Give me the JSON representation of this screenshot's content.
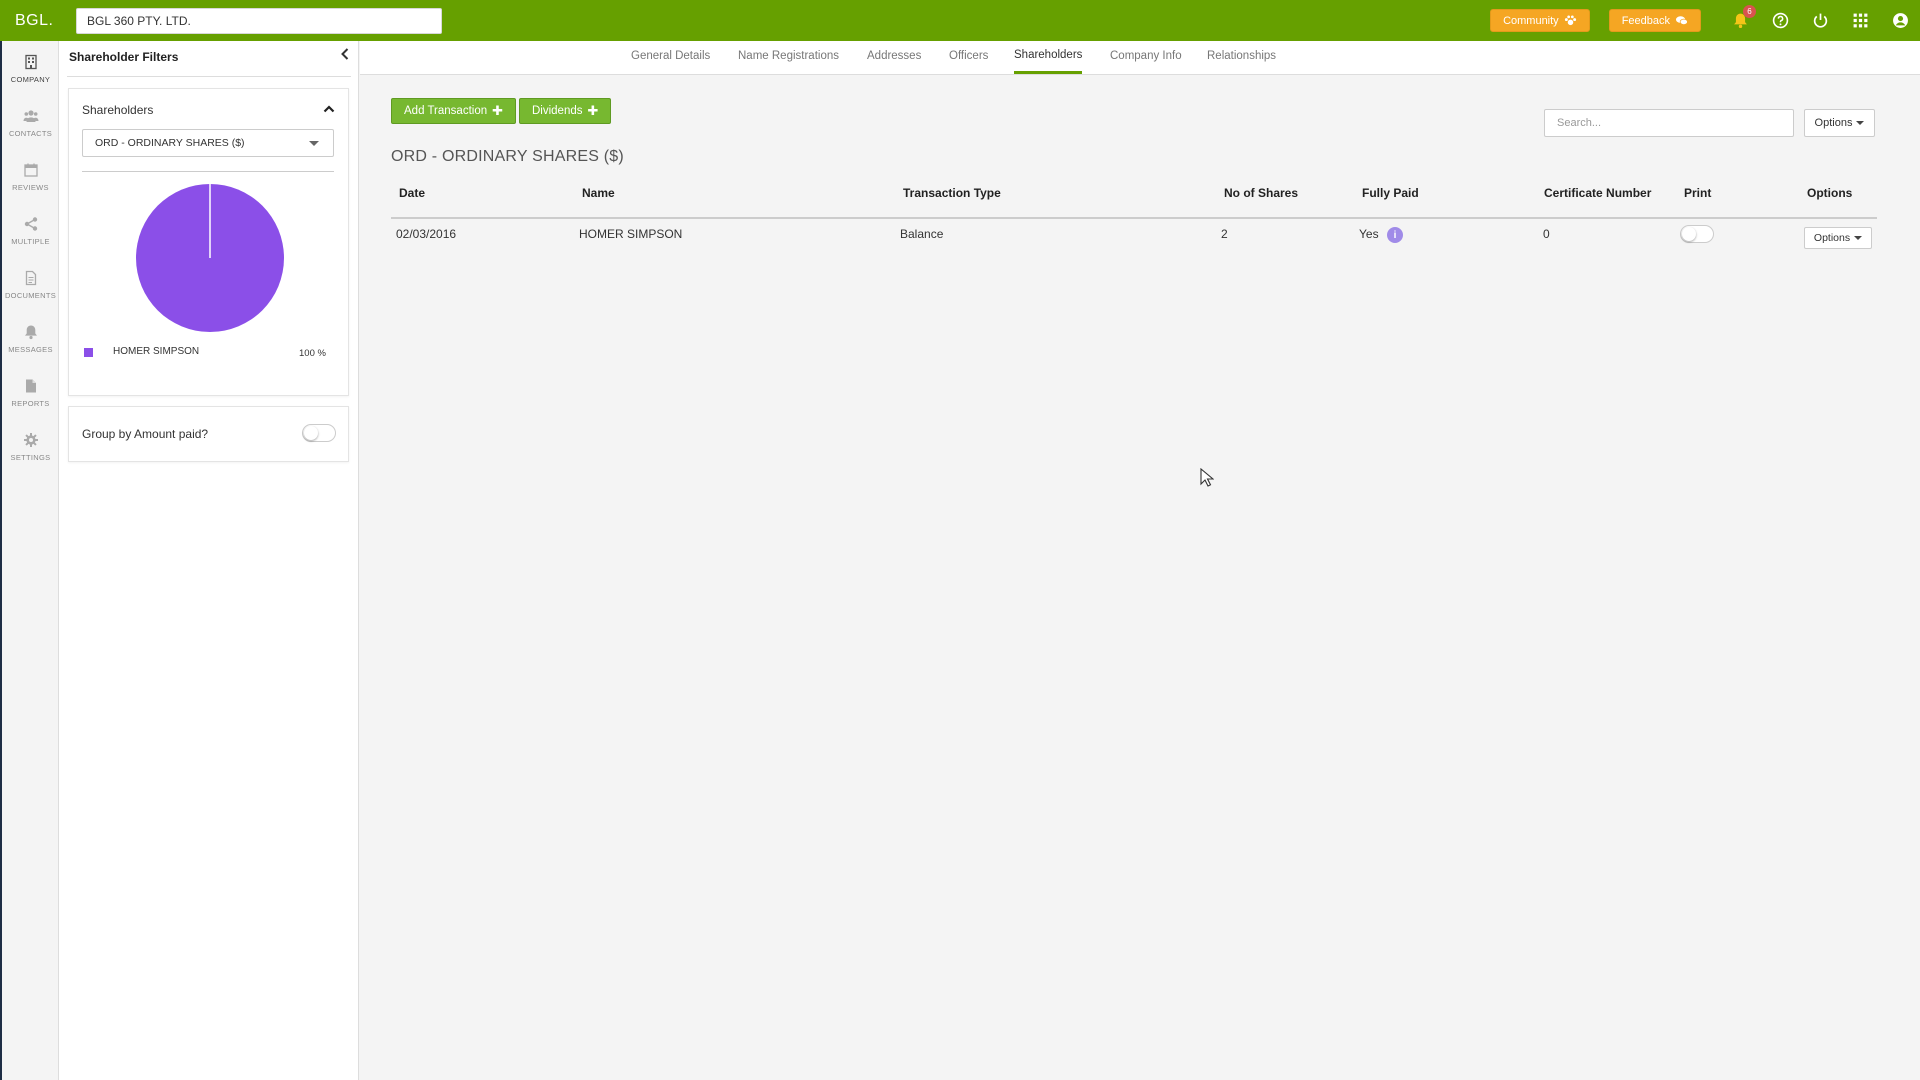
{
  "topbar": {
    "logo": "BGL.",
    "entity_name": "BGL 360 PTY. LTD.",
    "community_label": "Community",
    "feedback_label": "Feedback",
    "notification_count": "6",
    "colors": {
      "bar": "#66a000",
      "pill": "#f5a623"
    }
  },
  "leftnav": {
    "items": [
      {
        "label": "COMPANY",
        "icon": "building-icon"
      },
      {
        "label": "CONTACTS",
        "icon": "contacts-icon"
      },
      {
        "label": "REVIEWS",
        "icon": "calendar-icon"
      },
      {
        "label": "MULTIPLE",
        "icon": "share-icon"
      },
      {
        "label": "DOCUMENTS",
        "icon": "document-icon"
      },
      {
        "label": "MESSAGES",
        "icon": "bell-icon"
      },
      {
        "label": "REPORTS",
        "icon": "report-icon"
      },
      {
        "label": "SETTINGS",
        "icon": "gear-icon"
      }
    ]
  },
  "filters": {
    "title": "Shareholder Filters",
    "shareholders_heading": "Shareholders",
    "share_class_selected": "ORD - ORDINARY SHARES ($)",
    "group_by_label": "Group by Amount paid?",
    "group_by_enabled": false
  },
  "chart_data": {
    "type": "pie",
    "slices": [
      {
        "label": "HOMER SIMPSON",
        "value": 100,
        "display": "100 %",
        "color": "#8b4fe8"
      }
    ]
  },
  "tabs": [
    {
      "label": "General Details",
      "active": false
    },
    {
      "label": "Name Registrations",
      "active": false
    },
    {
      "label": "Addresses",
      "active": false
    },
    {
      "label": "Officers",
      "active": false
    },
    {
      "label": "Shareholders",
      "active": true
    },
    {
      "label": "Company Info",
      "active": false
    },
    {
      "label": "Relationships",
      "active": false
    }
  ],
  "main": {
    "add_transaction_label": "Add Transaction",
    "dividends_label": "Dividends",
    "search_placeholder": "Search...",
    "options_label": "Options",
    "section_title": "ORD - ORDINARY SHARES ($)"
  },
  "table": {
    "headers": [
      "Date",
      "Name",
      "Transaction Type",
      "No of Shares",
      "Fully Paid",
      "Certificate Number",
      "Print",
      "Options"
    ],
    "rows": [
      {
        "date": "02/03/2016",
        "name": "HOMER SIMPSON",
        "transaction_type": "Balance",
        "shares": "2",
        "fully_paid": "Yes",
        "certificate": "0",
        "print": false,
        "options_label": "Options"
      }
    ]
  }
}
